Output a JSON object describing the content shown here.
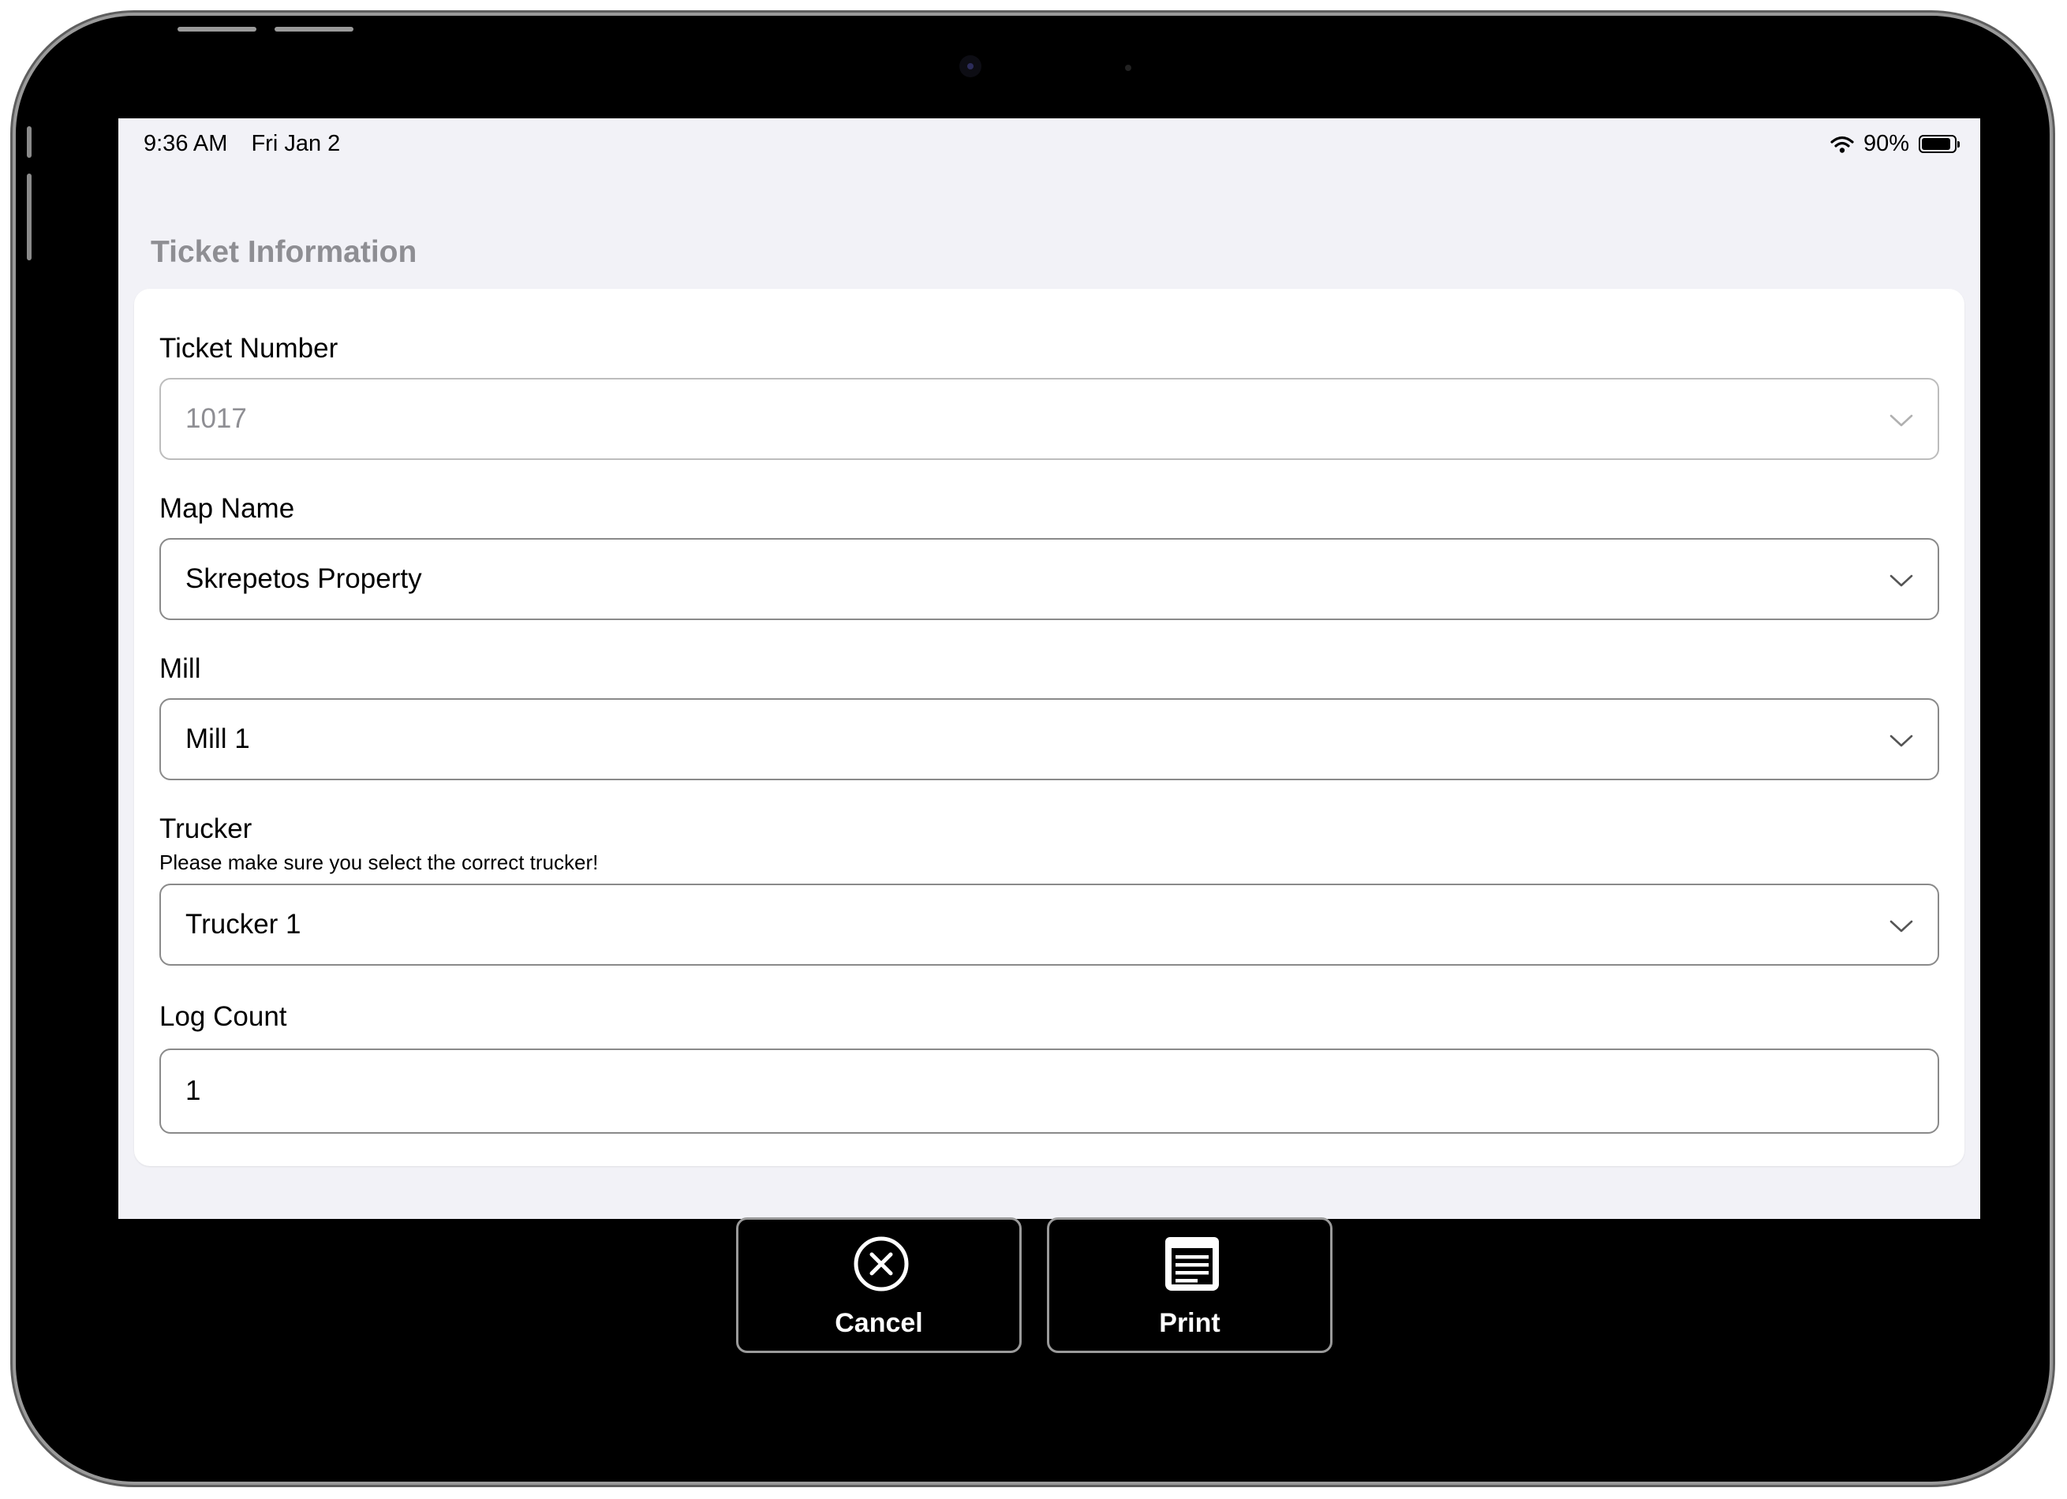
{
  "status_bar": {
    "time": "9:36 AM",
    "date": "Fri Jan 2",
    "battery": "90%",
    "battery_level": 0.9,
    "icons": [
      "wifi-icon",
      "battery-icon"
    ]
  },
  "form": {
    "section_title": "Ticket Information",
    "fields": {
      "ticket_number": {
        "label": "Ticket Number",
        "value": "1017",
        "icon": "chevron-down-icon"
      },
      "map_name": {
        "label": "Map Name",
        "value": "Skrepetos Property",
        "icon": "chevron-down-icon"
      },
      "mill": {
        "label": "Mill",
        "value": "Mill 1",
        "icon": "chevron-down-icon"
      },
      "trucker": {
        "label": "Trucker",
        "hint": "Please make sure you select the correct trucker!",
        "value": "Trucker 1",
        "icon": "chevron-down-icon"
      },
      "log_count": {
        "label": "Log Count",
        "value": "1"
      }
    }
  },
  "actions": {
    "cancel": {
      "label": "Cancel",
      "icon": "circle-x-icon"
    },
    "print": {
      "label": "Print",
      "icon": "document-icon"
    }
  },
  "colors": {
    "screen_bg": "#f2f2f7",
    "card_bg": "#ffffff",
    "section_header": "#8e8e93",
    "muted_text": "#8e8e93",
    "device_frame": "#000000"
  }
}
